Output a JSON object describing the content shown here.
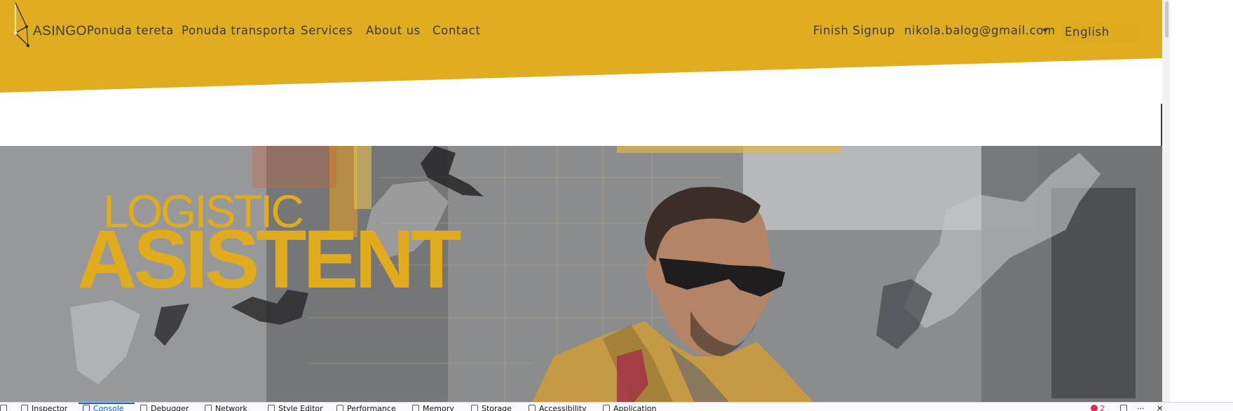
{
  "brand": {
    "logo_text": "ASINGO"
  },
  "nav": {
    "items": [
      {
        "label": "Ponuda tereta"
      },
      {
        "label": "Ponuda transporta"
      },
      {
        "label": "Services"
      },
      {
        "label": "About us"
      },
      {
        "label": "Contact"
      }
    ],
    "finish_signup": "Finish Signup",
    "user_email": "nikola.balog@gmail.com",
    "language": "English"
  },
  "hero": {
    "title_small": "LOGISTIC",
    "title_big": "ASISTENT"
  },
  "devtools": {
    "tabs": [
      {
        "label": "Inspector",
        "icon": "inspector-icon"
      },
      {
        "label": "Console",
        "icon": "console-icon"
      },
      {
        "label": "Debugger",
        "icon": "debugger-icon"
      },
      {
        "label": "Network",
        "icon": "network-icon"
      },
      {
        "label": "Style Editor",
        "icon": "style-editor-icon"
      },
      {
        "label": "Performance",
        "icon": "performance-icon"
      },
      {
        "label": "Memory",
        "icon": "memory-icon"
      },
      {
        "label": "Storage",
        "icon": "storage-icon"
      },
      {
        "label": "Accessibility",
        "icon": "accessibility-icon"
      },
      {
        "label": "Application",
        "icon": "application-icon"
      }
    ],
    "selected_tab": "Console",
    "error_count": "2",
    "more": "···"
  },
  "colors": {
    "header_bg": "#dfad1f",
    "accent_gold": "#e0ab1c",
    "nav_text": "#3d3a36",
    "devtools_bg": "#f9f9fb",
    "devtools_selected": "#0061e0",
    "error_red": "#e22850"
  }
}
